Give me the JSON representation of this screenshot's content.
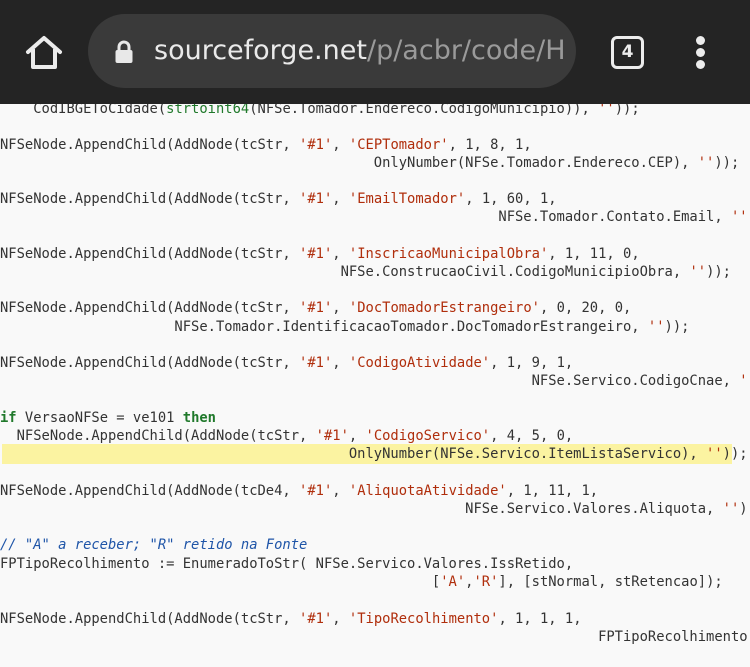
{
  "browser": {
    "url_host": "sourceforge.net",
    "url_path": "/p/acbr/code/H",
    "tab_count": "4",
    "icons": [
      "home-icon",
      "lock-icon",
      "tabs-icon",
      "menu-icon"
    ]
  },
  "code": {
    "l0_a": "    CodIBGEToCidade(",
    "l0_fn": "strtoint64",
    "l0_b": "(NFSe.Tomador.Endereco.CodigoMunicipio)), ",
    "l0_s": "''",
    "l0_c": "));",
    "l1_a": "NFSeNode.AppendChild(AddNode(tcStr, ",
    "l1_s1": "'#1'",
    "l1_b": ", ",
    "l1_s2": "'CEPTomador'",
    "l1_c": ", 1, 8, 1,",
    "l2_a": "                                             OnlyNumber(NFSe.Tomador.Endereco.CEP), ",
    "l2_s": "''",
    "l2_c": "));",
    "l3_a": "NFSeNode.AppendChild(AddNode(tcStr, ",
    "l3_s1": "'#1'",
    "l3_b": ", ",
    "l3_s2": "'EmailTomador'",
    "l3_c": ", 1, 60, 1,",
    "l4_a": "                                                            NFSe.Tomador.Contato.Email, ",
    "l4_s": "''",
    "l4_c": "));",
    "l5_a": "NFSeNode.AppendChild(AddNode(tcStr, ",
    "l5_s1": "'#1'",
    "l5_b": ", ",
    "l5_s2": "'InscricaoMunicipalObra'",
    "l5_c": ", 1, 11, 0,",
    "l6_a": "                                         NFSe.ConstrucaoCivil.CodigoMunicipioObra, ",
    "l6_s": "''",
    "l6_c": "));",
    "l7_a": "NFSeNode.AppendChild(AddNode(tcStr, ",
    "l7_s1": "'#1'",
    "l7_b": ", ",
    "l7_s2": "'DocTomadorEstrangeiro'",
    "l7_c": ", 0, 20, 0,",
    "l8_a": "                     NFSe.Tomador.IdentificacaoTomador.DocTomadorEstrangeiro, ",
    "l8_s": "''",
    "l8_c": "));",
    "l9_a": "NFSeNode.AppendChild(AddNode(tcStr, ",
    "l9_s1": "'#1'",
    "l9_b": ", ",
    "l9_s2": "'CodigoAtividade'",
    "l9_c": ", 1, 9, 1,",
    "l10_a": "                                                                NFSe.Servico.CodigoCnae, ",
    "l10_s": "''",
    "l10_c": "));",
    "l11_k1": "if",
    "l11_a": " VersaoNFSe = ve101 ",
    "l11_k2": "then",
    "l12_a": "  NFSeNode.AppendChild(AddNode(tcStr, ",
    "l12_s1": "'#1'",
    "l12_b": ", ",
    "l12_s2": "'CodigoServico'",
    "l12_c": ", 4, 5, 0,",
    "l13_a": "                                          OnlyNumber(NFSe.Servico.ItemListaServico), ",
    "l13_s": "''",
    "l13_c": "));",
    "l14_a": "NFSeNode.AppendChild(AddNode(tcDe4, ",
    "l14_s1": "'#1'",
    "l14_b": ", ",
    "l14_s2": "'AliquotaAtividade'",
    "l14_c": ", 1, 11, 1,",
    "l15_a": "                                                        NFSe.Servico.Valores.Aliquota, ",
    "l15_s": "''",
    "l15_c": "));",
    "l16_cm": "// \"A\" a receber; \"R\" retido na Fonte",
    "l17_a": "FPTipoRecolhimento := EnumeradoToStr( NFSe.Servico.Valores.IssRetido,",
    "l18_a": "                                                    [",
    "l18_s1": "'A'",
    "l18_b": ",",
    "l18_s2": "'R'",
    "l18_c": "], [stNormal, stRetencao]);",
    "l19_a": "NFSeNode.AppendChild(AddNode(tcStr, ",
    "l19_s1": "'#1'",
    "l19_b": ", ",
    "l19_s2": "'TipoRecolhimento'",
    "l19_c": ", 1, 1, 1,",
    "l20_a": "                                                                        FPTipoRecolhimento, ",
    "l20_s": "''",
    "l20_c": "));"
  }
}
